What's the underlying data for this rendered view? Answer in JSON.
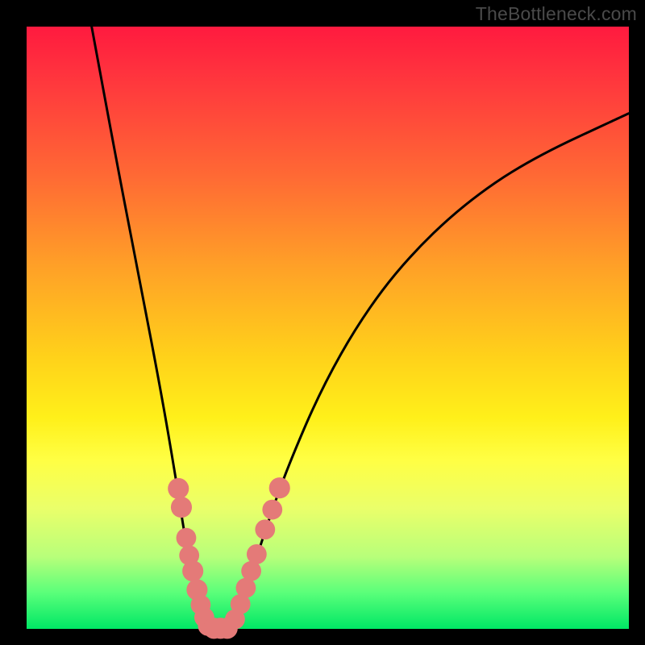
{
  "watermark": "TheBottleneck.com",
  "colors": {
    "frame": "#000000",
    "curve": "#000000",
    "dot_fill": "#e47a78",
    "gradient_top": "#ff1a3f",
    "gradient_bottom": "#00e765"
  },
  "chart_data": {
    "type": "line",
    "title": "",
    "xlabel": "",
    "ylabel": "",
    "xlim": [
      0,
      100
    ],
    "ylim": [
      0,
      100
    ],
    "notes": "V-shaped curve on a vertical red-to-green gradient background. Axes are unlabeled; values below are estimated from pixel positions (0,0 at bottom-left of plot, 100,100 at top-right). Pink dots cluster along the lower portion of both curve branches.",
    "series": [
      {
        "name": "left-branch",
        "x": [
          10.8,
          15.3,
          19.1,
          22.4,
          24.7,
          26.5,
          27.8,
          28.8,
          29.7,
          30.6
        ],
        "y": [
          100.0,
          75.7,
          56.2,
          38.9,
          25.5,
          13.9,
          7.8,
          4.1,
          1.9,
          0.2
        ]
      },
      {
        "name": "right-branch",
        "x": [
          34.1,
          35.4,
          37.3,
          40.1,
          43.4,
          48.9,
          55.4,
          62.7,
          72.3,
          83.4,
          100.0
        ],
        "y": [
          0.2,
          3.4,
          9.1,
          17.8,
          27.0,
          39.8,
          51.3,
          61.0,
          70.3,
          77.9,
          85.6
        ]
      }
    ],
    "dots": [
      {
        "x": 25.2,
        "y": 23.3,
        "r": 1.2
      },
      {
        "x": 25.7,
        "y": 20.2,
        "r": 1.2
      },
      {
        "x": 26.5,
        "y": 15.1,
        "r": 1.1
      },
      {
        "x": 27.0,
        "y": 12.2,
        "r": 1.1
      },
      {
        "x": 27.6,
        "y": 9.6,
        "r": 1.2
      },
      {
        "x": 28.3,
        "y": 6.5,
        "r": 1.2
      },
      {
        "x": 28.9,
        "y": 4.0,
        "r": 1.1
      },
      {
        "x": 29.5,
        "y": 1.9,
        "r": 1.1
      },
      {
        "x": 30.1,
        "y": 0.5,
        "r": 1.1
      },
      {
        "x": 31.1,
        "y": 0.1,
        "r": 1.2
      },
      {
        "x": 32.2,
        "y": 0.1,
        "r": 1.2
      },
      {
        "x": 33.3,
        "y": 0.1,
        "r": 1.2
      },
      {
        "x": 34.6,
        "y": 1.6,
        "r": 1.1
      },
      {
        "x": 35.5,
        "y": 4.1,
        "r": 1.1
      },
      {
        "x": 36.4,
        "y": 6.8,
        "r": 1.1
      },
      {
        "x": 37.3,
        "y": 9.6,
        "r": 1.1
      },
      {
        "x": 38.2,
        "y": 12.4,
        "r": 1.1
      },
      {
        "x": 39.6,
        "y": 16.5,
        "r": 1.1
      },
      {
        "x": 40.8,
        "y": 19.8,
        "r": 1.1
      },
      {
        "x": 42.0,
        "y": 23.4,
        "r": 1.2
      }
    ]
  }
}
